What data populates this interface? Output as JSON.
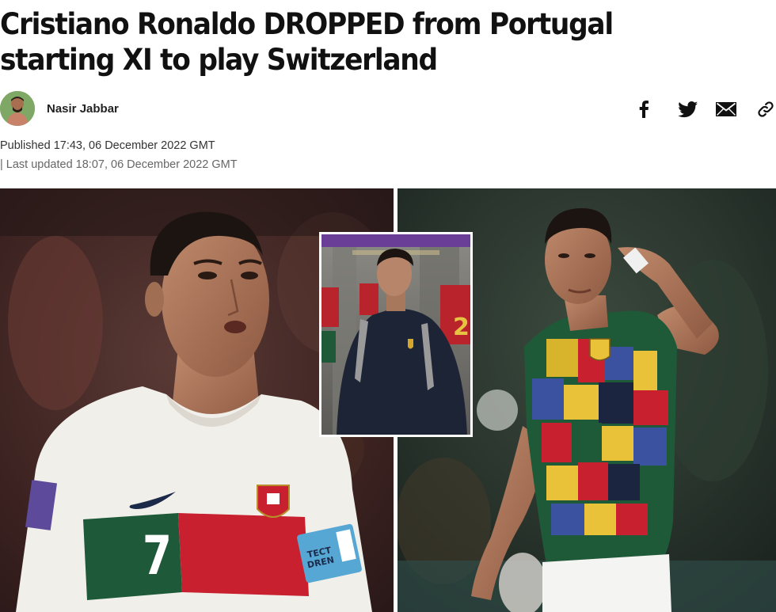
{
  "article": {
    "headline": "Cristiano Ronaldo DROPPED from Portugal starting XI to play Switzerland",
    "author": {
      "name": "Nasir Jabbar"
    },
    "published": "Published 17:43, 06 December 2022 GMT",
    "updated": "| Last updated 18:07, 06 December 2022 GMT"
  },
  "share": {
    "icons": [
      "facebook-icon",
      "twitter-icon",
      "email-icon",
      "link-icon"
    ]
  },
  "hero": {
    "left_shirt_number": "7",
    "armband_text": [
      "TECT",
      "DREN"
    ],
    "inset_shirt_number": "2"
  },
  "colors": {
    "headline": "#111111",
    "text_muted": "#666666",
    "portugal_red": "#c8202e",
    "portugal_green": "#1e5a3a",
    "inset_border_top": "#6a3d96"
  }
}
